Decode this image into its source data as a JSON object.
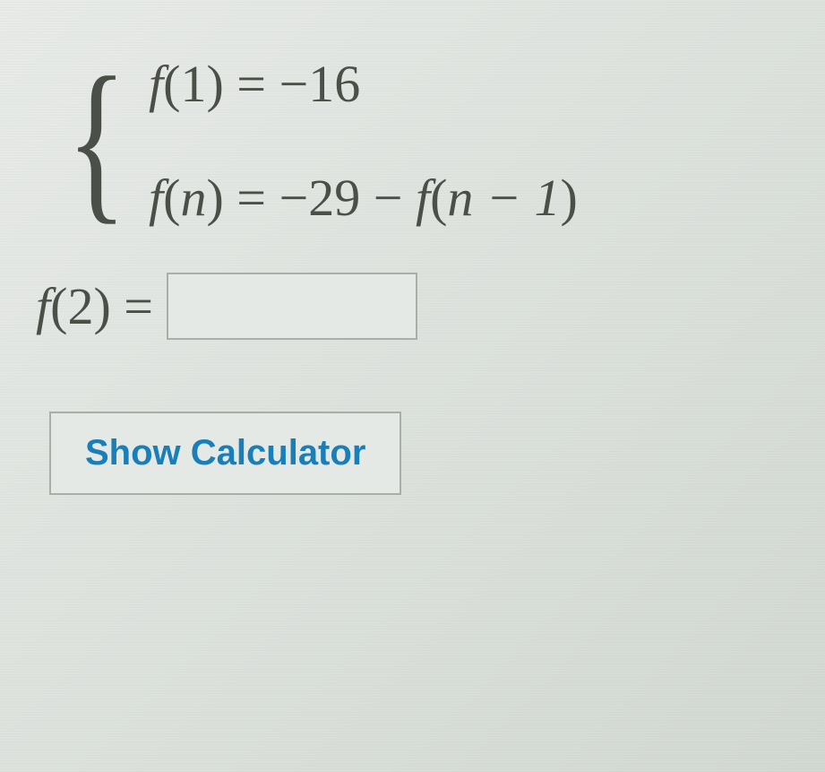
{
  "problem": {
    "equation1": {
      "lhs_func": "f",
      "lhs_arg": "1",
      "rhs": "−16"
    },
    "equation2": {
      "lhs_func": "f",
      "lhs_arg": "n",
      "rhs_const": "−29",
      "rhs_func": "f",
      "rhs_arg": "n − 1"
    },
    "question": {
      "func": "f",
      "arg": "2"
    }
  },
  "answer_value": "",
  "buttons": {
    "show_calculator": "Show Calculator"
  }
}
